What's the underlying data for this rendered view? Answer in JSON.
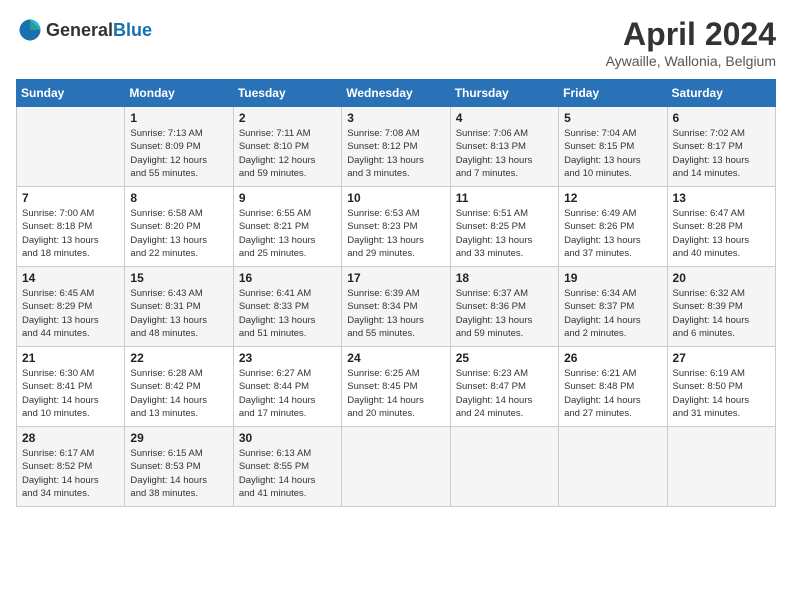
{
  "header": {
    "logo_general": "General",
    "logo_blue": "Blue",
    "month_title": "April 2024",
    "location": "Aywaille, Wallonia, Belgium"
  },
  "days_of_week": [
    "Sunday",
    "Monday",
    "Tuesday",
    "Wednesday",
    "Thursday",
    "Friday",
    "Saturday"
  ],
  "weeks": [
    [
      {
        "day": "",
        "info": ""
      },
      {
        "day": "1",
        "info": "Sunrise: 7:13 AM\nSunset: 8:09 PM\nDaylight: 12 hours\nand 55 minutes."
      },
      {
        "day": "2",
        "info": "Sunrise: 7:11 AM\nSunset: 8:10 PM\nDaylight: 12 hours\nand 59 minutes."
      },
      {
        "day": "3",
        "info": "Sunrise: 7:08 AM\nSunset: 8:12 PM\nDaylight: 13 hours\nand 3 minutes."
      },
      {
        "day": "4",
        "info": "Sunrise: 7:06 AM\nSunset: 8:13 PM\nDaylight: 13 hours\nand 7 minutes."
      },
      {
        "day": "5",
        "info": "Sunrise: 7:04 AM\nSunset: 8:15 PM\nDaylight: 13 hours\nand 10 minutes."
      },
      {
        "day": "6",
        "info": "Sunrise: 7:02 AM\nSunset: 8:17 PM\nDaylight: 13 hours\nand 14 minutes."
      }
    ],
    [
      {
        "day": "7",
        "info": "Sunrise: 7:00 AM\nSunset: 8:18 PM\nDaylight: 13 hours\nand 18 minutes."
      },
      {
        "day": "8",
        "info": "Sunrise: 6:58 AM\nSunset: 8:20 PM\nDaylight: 13 hours\nand 22 minutes."
      },
      {
        "day": "9",
        "info": "Sunrise: 6:55 AM\nSunset: 8:21 PM\nDaylight: 13 hours\nand 25 minutes."
      },
      {
        "day": "10",
        "info": "Sunrise: 6:53 AM\nSunset: 8:23 PM\nDaylight: 13 hours\nand 29 minutes."
      },
      {
        "day": "11",
        "info": "Sunrise: 6:51 AM\nSunset: 8:25 PM\nDaylight: 13 hours\nand 33 minutes."
      },
      {
        "day": "12",
        "info": "Sunrise: 6:49 AM\nSunset: 8:26 PM\nDaylight: 13 hours\nand 37 minutes."
      },
      {
        "day": "13",
        "info": "Sunrise: 6:47 AM\nSunset: 8:28 PM\nDaylight: 13 hours\nand 40 minutes."
      }
    ],
    [
      {
        "day": "14",
        "info": "Sunrise: 6:45 AM\nSunset: 8:29 PM\nDaylight: 13 hours\nand 44 minutes."
      },
      {
        "day": "15",
        "info": "Sunrise: 6:43 AM\nSunset: 8:31 PM\nDaylight: 13 hours\nand 48 minutes."
      },
      {
        "day": "16",
        "info": "Sunrise: 6:41 AM\nSunset: 8:33 PM\nDaylight: 13 hours\nand 51 minutes."
      },
      {
        "day": "17",
        "info": "Sunrise: 6:39 AM\nSunset: 8:34 PM\nDaylight: 13 hours\nand 55 minutes."
      },
      {
        "day": "18",
        "info": "Sunrise: 6:37 AM\nSunset: 8:36 PM\nDaylight: 13 hours\nand 59 minutes."
      },
      {
        "day": "19",
        "info": "Sunrise: 6:34 AM\nSunset: 8:37 PM\nDaylight: 14 hours\nand 2 minutes."
      },
      {
        "day": "20",
        "info": "Sunrise: 6:32 AM\nSunset: 8:39 PM\nDaylight: 14 hours\nand 6 minutes."
      }
    ],
    [
      {
        "day": "21",
        "info": "Sunrise: 6:30 AM\nSunset: 8:41 PM\nDaylight: 14 hours\nand 10 minutes."
      },
      {
        "day": "22",
        "info": "Sunrise: 6:28 AM\nSunset: 8:42 PM\nDaylight: 14 hours\nand 13 minutes."
      },
      {
        "day": "23",
        "info": "Sunrise: 6:27 AM\nSunset: 8:44 PM\nDaylight: 14 hours\nand 17 minutes."
      },
      {
        "day": "24",
        "info": "Sunrise: 6:25 AM\nSunset: 8:45 PM\nDaylight: 14 hours\nand 20 minutes."
      },
      {
        "day": "25",
        "info": "Sunrise: 6:23 AM\nSunset: 8:47 PM\nDaylight: 14 hours\nand 24 minutes."
      },
      {
        "day": "26",
        "info": "Sunrise: 6:21 AM\nSunset: 8:48 PM\nDaylight: 14 hours\nand 27 minutes."
      },
      {
        "day": "27",
        "info": "Sunrise: 6:19 AM\nSunset: 8:50 PM\nDaylight: 14 hours\nand 31 minutes."
      }
    ],
    [
      {
        "day": "28",
        "info": "Sunrise: 6:17 AM\nSunset: 8:52 PM\nDaylight: 14 hours\nand 34 minutes."
      },
      {
        "day": "29",
        "info": "Sunrise: 6:15 AM\nSunset: 8:53 PM\nDaylight: 14 hours\nand 38 minutes."
      },
      {
        "day": "30",
        "info": "Sunrise: 6:13 AM\nSunset: 8:55 PM\nDaylight: 14 hours\nand 41 minutes."
      },
      {
        "day": "",
        "info": ""
      },
      {
        "day": "",
        "info": ""
      },
      {
        "day": "",
        "info": ""
      },
      {
        "day": "",
        "info": ""
      }
    ]
  ]
}
